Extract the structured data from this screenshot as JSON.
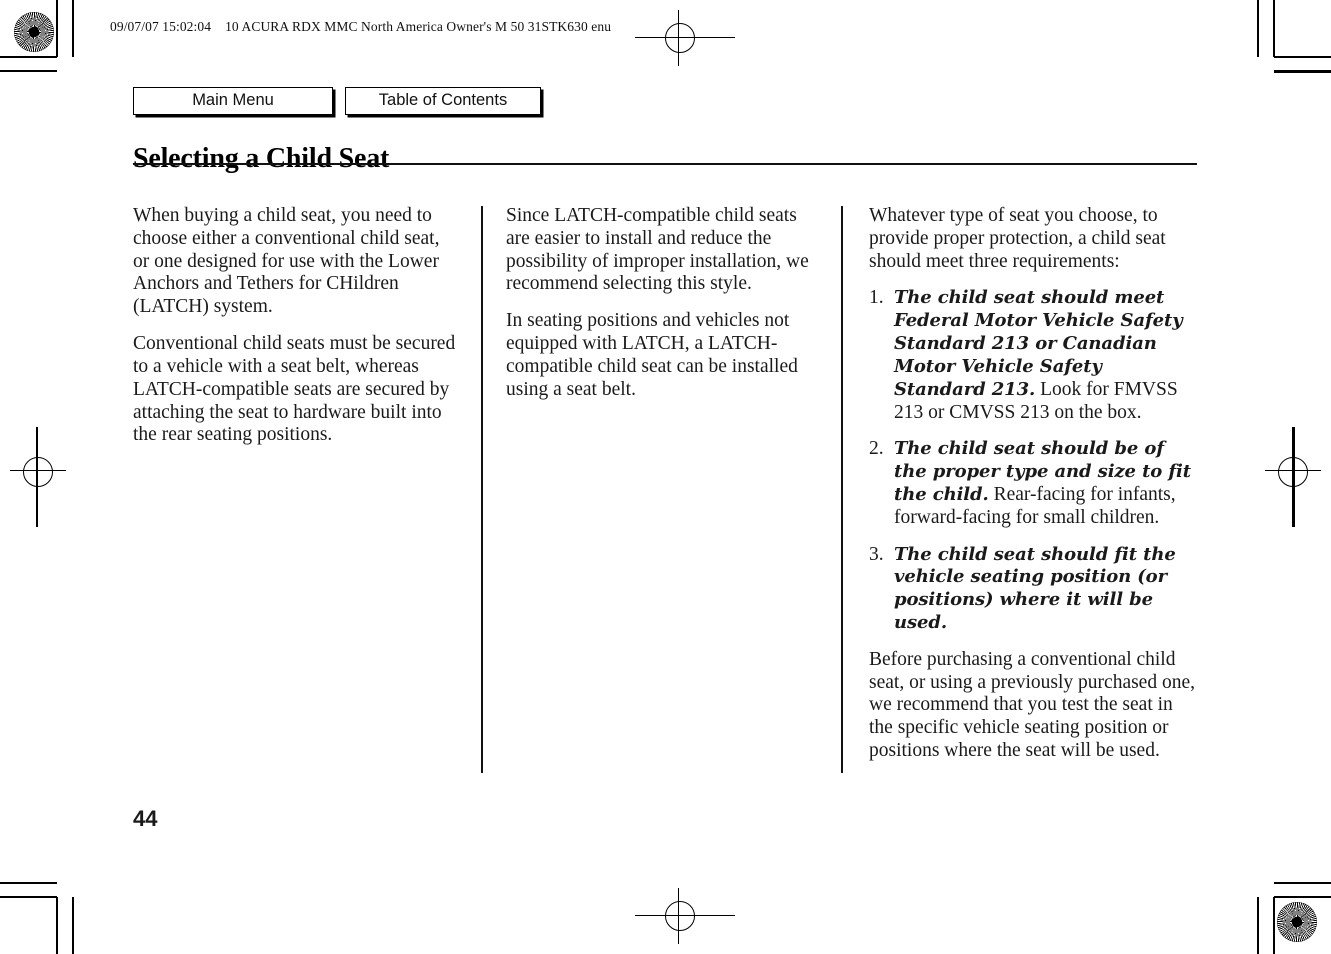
{
  "print_header": {
    "timestamp": "09/07/07 15:02:04",
    "job_info": "10 ACURA RDX MMC North America Owner's M 50 31STK630 enu"
  },
  "nav": {
    "main_menu_label": "Main Menu",
    "table_of_contents_label": "Table of Contents"
  },
  "page": {
    "title": "Selecting a Child Seat",
    "number": "44"
  },
  "columns": {
    "col1": {
      "paragraphs": [
        "When buying a child seat, you need to choose either a conventional child seat, or one designed for use with the Lower Anchors and Tethers for CHildren (LATCH) system.",
        "Conventional child seats must be secured to a vehicle with a seat belt, whereas LATCH-compatible seats are secured by attaching the seat to hardware built into the rear seating positions."
      ]
    },
    "col2": {
      "paragraphs": [
        "Since LATCH-compatible child seats are easier to install and reduce the possibility of improper installation, we recommend selecting this style.",
        "In seating positions and vehicles not equipped with LATCH, a LATCH-compatible child seat can be installed using a seat belt."
      ]
    },
    "col3": {
      "intro": "Whatever type of seat you choose, to provide proper protection, a child seat should meet three requirements:",
      "requirements": [
        {
          "number": "1.",
          "lead": "The child seat should meet Federal Motor Vehicle Safety Standard 213 or Canadian Motor Vehicle Safety Standard 213.",
          "rest": " Look for FMVSS 213 or CMVSS 213 on the box."
        },
        {
          "number": "2.",
          "lead": "The child seat should be of the proper type and size to fit the child.",
          "rest": " Rear-facing for infants, forward-facing for small children."
        },
        {
          "number": "3.",
          "lead": "The child seat should fit the vehicle seating position (or positions) where it will be used.",
          "rest": ""
        }
      ],
      "closing": "Before purchasing a conventional child seat, or using a previously purchased one, we recommend that you test the seat in the specific vehicle seating position or positions where the seat will be used."
    }
  },
  "colors": {
    "ink": "#1a1a1a",
    "rule": "#111111",
    "paper": "#ffffff"
  }
}
